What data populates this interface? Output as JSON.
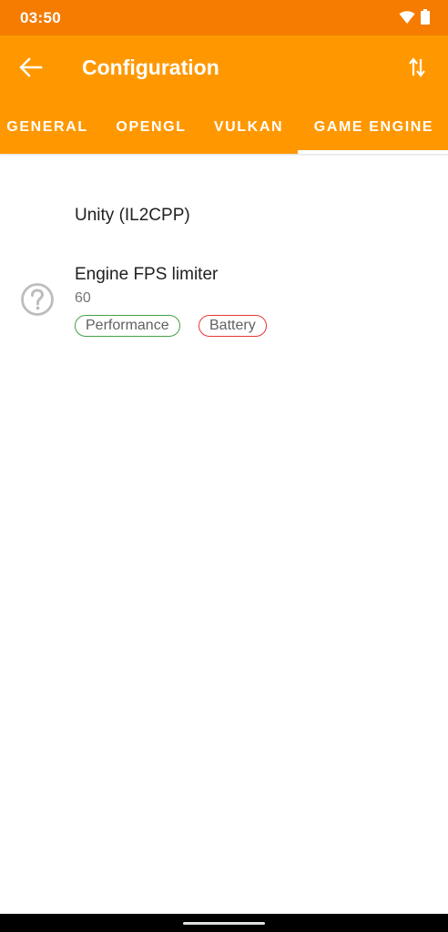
{
  "status_bar": {
    "time": "03:50",
    "icons": [
      "wifi-icon",
      "battery-icon"
    ]
  },
  "app_bar": {
    "title": "Configuration",
    "back_icon": "arrow-left-icon",
    "action_icon": "swap-vertical-icon"
  },
  "tabs": [
    {
      "label": "GENERAL",
      "selected": false
    },
    {
      "label": "OPENGL",
      "selected": false
    },
    {
      "label": "VULKAN",
      "selected": false
    },
    {
      "label": "GAME ENGINE",
      "selected": true
    }
  ],
  "content": {
    "engine": "Unity (IL2CPP)",
    "preference": {
      "icon": "help-circle-icon",
      "title": "Engine FPS limiter",
      "summary": "60",
      "tags": [
        {
          "label": "Performance",
          "color": "#43a047"
        },
        {
          "label": "Battery",
          "color": "#e53935"
        }
      ]
    }
  },
  "colors": {
    "status_bar": "#f57c00",
    "primary": "#ff9800",
    "text_primary": "#212121",
    "text_secondary": "#757575"
  }
}
